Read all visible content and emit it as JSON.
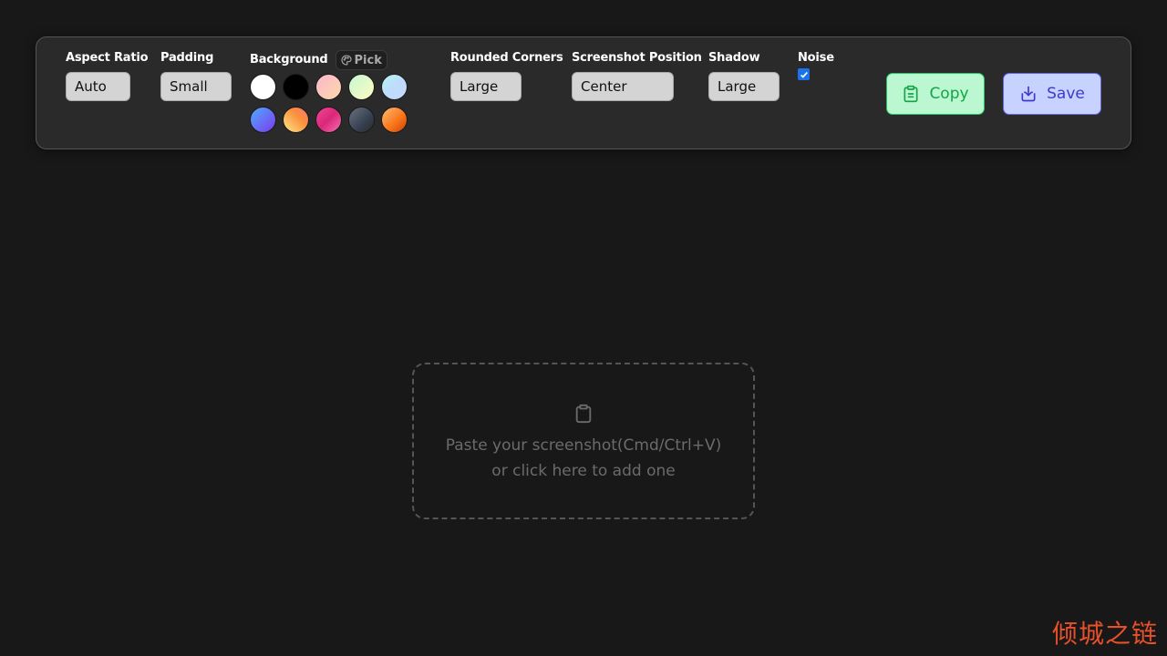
{
  "toolbar": {
    "aspect_ratio": {
      "label": "Aspect Ratio",
      "value": "Auto"
    },
    "padding": {
      "label": "Padding",
      "value": "Small"
    },
    "background": {
      "label": "Background",
      "pick_label": "Pick",
      "swatches": [
        {
          "name": "white",
          "css": "#ffffff"
        },
        {
          "name": "black",
          "css": "#000000"
        },
        {
          "name": "pink-peach",
          "css": "linear-gradient(135deg,#fbb6ce 0%,#fcd9a8 100%)"
        },
        {
          "name": "mint-yellow",
          "css": "linear-gradient(135deg,#c6f6d5 0%,#fefcbf 100%)"
        },
        {
          "name": "aqua-blue",
          "css": "linear-gradient(135deg,#b2f5ea 0%,#bfdbfe 50%,#c3dafe 100%)"
        },
        {
          "name": "blue-violet",
          "css": "linear-gradient(135deg,#4facfe 0%,#7c3aed 100%)"
        },
        {
          "name": "coral-yellow",
          "css": "linear-gradient(45deg,#fde68a 0%,#fb923c 60%,#f87171 100%)"
        },
        {
          "name": "magenta-pink",
          "css": "linear-gradient(135deg,#ec4899 0%,#db2777 50%,#f472b6 100%)"
        },
        {
          "name": "graphite",
          "css": "linear-gradient(135deg,#6b7280 0%,#374151 60%,#2a2a2a 100%)"
        },
        {
          "name": "orange",
          "css": "linear-gradient(135deg,#fdba74 0%,#f97316 60%,#c2410c 100%)"
        }
      ]
    },
    "rounded_corners": {
      "label": "Rounded Corners",
      "value": "Large"
    },
    "screenshot_position": {
      "label": "Screenshot Position",
      "value": "Center"
    },
    "shadow": {
      "label": "Shadow",
      "value": "Large"
    },
    "noise": {
      "label": "Noise",
      "checked": true
    },
    "copy_label": "Copy",
    "save_label": "Save"
  },
  "dropzone": {
    "line1": "Paste your screenshot(Cmd/Ctrl+V)",
    "line2": "or click here to add one"
  },
  "watermark": "倾城之链",
  "colors": {
    "page_bg": "#181818",
    "toolbar_bg": "#2a2a2a",
    "copy_accent": "#16a34a",
    "save_accent": "#4338ca",
    "checkbox": "#1a73e8",
    "watermark": "#e8502a"
  }
}
